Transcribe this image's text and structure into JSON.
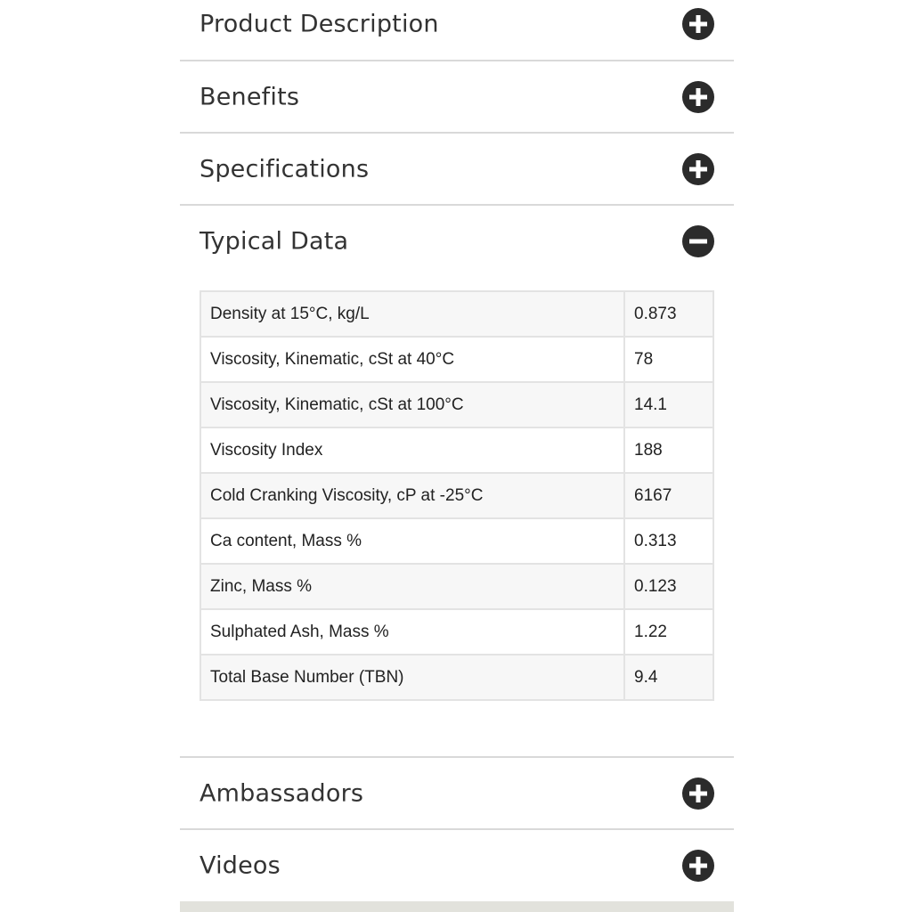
{
  "accordion": {
    "sections_top": [
      {
        "title": "Product Description",
        "state": "collapsed",
        "icon": "plus-circle-icon"
      },
      {
        "title": "Benefits",
        "state": "collapsed",
        "icon": "plus-circle-icon"
      },
      {
        "title": "Specifications",
        "state": "collapsed",
        "icon": "plus-circle-icon"
      }
    ],
    "open_section": {
      "title": "Typical Data",
      "state": "expanded",
      "icon": "minus-circle-icon"
    },
    "sections_bottom": [
      {
        "title": "Ambassadors",
        "state": "collapsed",
        "icon": "plus-circle-icon"
      },
      {
        "title": "Videos",
        "state": "collapsed",
        "icon": "plus-circle-icon"
      }
    ]
  },
  "typical_data": {
    "rows": [
      {
        "property": "Density at 15°C, kg/L",
        "value": "0.873"
      },
      {
        "property": "Viscosity, Kinematic, cSt at 40°C",
        "value": "78"
      },
      {
        "property": "Viscosity, Kinematic, cSt at 100°C",
        "value": "14.1"
      },
      {
        "property": "Viscosity Index",
        "value": "188"
      },
      {
        "property": "Cold Cranking Viscosity, cP at -25°C",
        "value": "6167"
      },
      {
        "property": "Ca content, Mass %",
        "value": "0.313"
      },
      {
        "property": "Zinc, Mass %",
        "value": "0.123"
      },
      {
        "property": "Sulphated Ash, Mass %",
        "value": "1.22"
      },
      {
        "property": "Total Base Number (TBN)",
        "value": "9.4"
      }
    ]
  },
  "colors": {
    "icon": "#2b2b2b",
    "divider": "#d9d9d9",
    "table_border": "#e3e3e3",
    "row_alt": "#f7f7f7"
  }
}
